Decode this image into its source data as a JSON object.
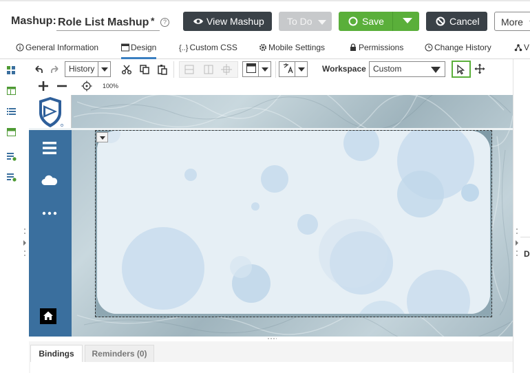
{
  "header": {
    "mashup_label": "Mashup:",
    "mashup_name": "Role List Mashup",
    "unsaved_marker": "*",
    "help_glyph": "?",
    "buttons": {
      "view_mashup": "View Mashup",
      "todo": "To Do",
      "save": "Save",
      "cancel": "Cancel",
      "more": "More"
    }
  },
  "tabs": [
    {
      "label": "General Information",
      "icon": "info-icon"
    },
    {
      "label": "Design",
      "icon": "design-icon",
      "active": true
    },
    {
      "label": "Custom CSS",
      "icon": "css-braces-icon"
    },
    {
      "label": "Mobile Settings",
      "icon": "gear-icon"
    },
    {
      "label": "Permissions",
      "icon": "lock-icon"
    },
    {
      "label": "Change History",
      "icon": "clock-icon"
    },
    {
      "label": "V",
      "icon": "visualization-icon"
    }
  ],
  "toolbar": {
    "history_label": "History",
    "workspace_label": "Workspace",
    "workspace_value": "Custom",
    "zoom": "100%"
  },
  "bottom_panel": {
    "tabs": [
      {
        "label": "Bindings",
        "active": true
      },
      {
        "label": "Reminders (0)"
      }
    ]
  },
  "right_panel": {
    "label": "D"
  },
  "colors": {
    "accent": "#3a7fc1",
    "save_green": "#5aaf3a",
    "dark_button": "#3a4147",
    "nav_blue": "#3a6f9e",
    "panel_fill": "#e6eff5"
  }
}
